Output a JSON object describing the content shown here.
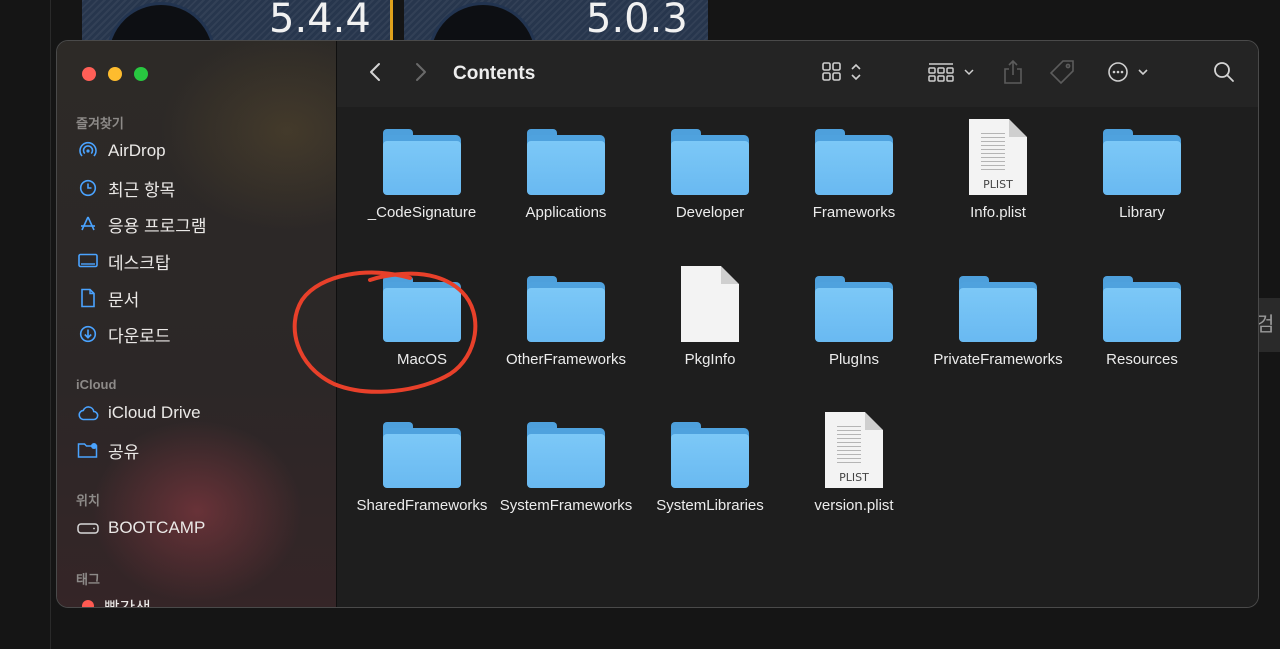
{
  "background": {
    "version_left": "5.4.4",
    "version_right": "5.0.3",
    "side_text": "검"
  },
  "window": {
    "title": "Contents",
    "toolbar": {
      "back_icon": "chevron-left-icon",
      "forward_icon": "chevron-right-icon",
      "view_icon": "icon-grid-view-icon",
      "group_icon": "group-by-icon",
      "share_icon": "share-icon",
      "tag_icon": "tag-icon",
      "more_icon": "ellipsis-circle-icon",
      "search_icon": "search-icon"
    },
    "traffic_colors": {
      "close": "#ff5f57",
      "minimize": "#febc2e",
      "zoom": "#28c840"
    }
  },
  "sidebar": {
    "favorites_heading": "즐겨찾기",
    "favorites": [
      {
        "label": "AirDrop",
        "icon": "airdrop-icon"
      },
      {
        "label": "최근 항목",
        "icon": "clock-icon"
      },
      {
        "label": "응용 프로그램",
        "icon": "applications-icon"
      },
      {
        "label": "데스크탑",
        "icon": "desktop-icon"
      },
      {
        "label": "문서",
        "icon": "document-icon"
      },
      {
        "label": "다운로드",
        "icon": "download-icon"
      }
    ],
    "icloud_heading": "iCloud",
    "icloud": [
      {
        "label": "iCloud Drive",
        "icon": "cloud-icon"
      },
      {
        "label": "공유",
        "icon": "shared-folder-icon"
      }
    ],
    "locations_heading": "위치",
    "locations": [
      {
        "label": "BOOTCAMP",
        "icon": "drive-icon"
      }
    ],
    "tags_heading": "태그",
    "tags": [
      {
        "label": "빨간색",
        "color": "#ff5a52"
      }
    ]
  },
  "files": [
    {
      "name": "_CodeSignature",
      "kind": "folder"
    },
    {
      "name": "Applications",
      "kind": "folder"
    },
    {
      "name": "Developer",
      "kind": "folder"
    },
    {
      "name": "Frameworks",
      "kind": "folder"
    },
    {
      "name": "Info.plist",
      "kind": "plist",
      "badge": "PLIST"
    },
    {
      "name": "Library",
      "kind": "folder"
    },
    {
      "name": "MacOS",
      "kind": "folder",
      "annotated": true
    },
    {
      "name": "OtherFrameworks",
      "kind": "folder"
    },
    {
      "name": "PkgInfo",
      "kind": "document"
    },
    {
      "name": "PlugIns",
      "kind": "folder"
    },
    {
      "name": "PrivateFrameworks",
      "kind": "folder"
    },
    {
      "name": "Resources",
      "kind": "folder"
    },
    {
      "name": "SharedFrameworks",
      "kind": "folder"
    },
    {
      "name": "SystemFrameworks",
      "kind": "folder"
    },
    {
      "name": "SystemLibraries",
      "kind": "folder"
    },
    {
      "name": "version.plist",
      "kind": "plist",
      "badge": "PLIST"
    }
  ],
  "annotation_color": "#e8402a"
}
